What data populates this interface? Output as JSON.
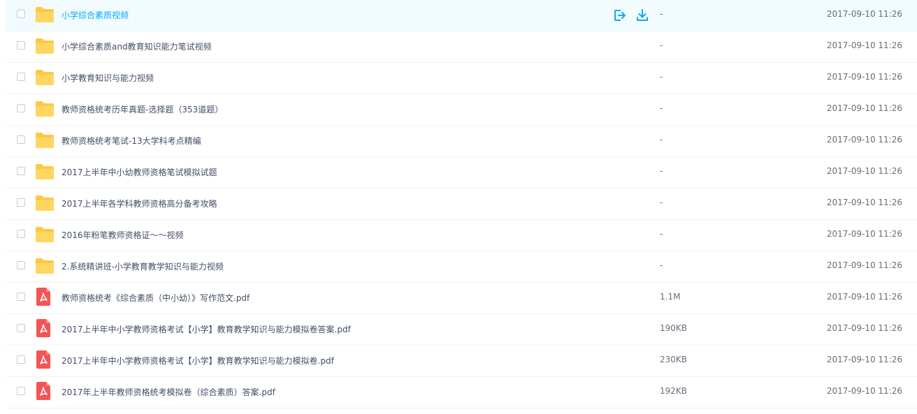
{
  "files": [
    {
      "name": "小学综合素质视频",
      "type": "folder",
      "size": "-",
      "date": "2017-09-10 11:26",
      "hovered": true
    },
    {
      "name": "小学综合素质and教育知识能力笔试视频",
      "type": "folder",
      "size": "-",
      "date": "2017-09-10 11:26"
    },
    {
      "name": "小学教育知识与能力视频",
      "type": "folder",
      "size": "-",
      "date": "2017-09-10 11:26"
    },
    {
      "name": "教师资格统考历年真题-选择题（353道题）",
      "type": "folder",
      "size": "-",
      "date": "2017-09-10 11:26"
    },
    {
      "name": "教师资格统考笔试-13大学科考点精编",
      "type": "folder",
      "size": "-",
      "date": "2017-09-10 11:26"
    },
    {
      "name": "2017上半年中小幼教师资格笔试模拟试题",
      "type": "folder",
      "size": "-",
      "date": "2017-09-10 11:26"
    },
    {
      "name": "2017上半年各学科教师资格高分备考攻略",
      "type": "folder",
      "size": "-",
      "date": "2017-09-10 11:26"
    },
    {
      "name": "2016年粉笔教师资格证～～视频",
      "type": "folder",
      "size": "-",
      "date": "2017-09-10 11:26"
    },
    {
      "name": "2.系统精讲班-小学教育教学知识与能力视频",
      "type": "folder",
      "size": "-",
      "date": "2017-09-10 11:26"
    },
    {
      "name": "教师资格统考《综合素质（中小幼）》写作范文.pdf",
      "type": "pdf",
      "size": "1.1M",
      "date": "2017-09-10 11:26"
    },
    {
      "name": "2017上半年中小学教师资格考试【小学】教育教学知识与能力模拟卷答案.pdf",
      "type": "pdf",
      "size": "190KB",
      "date": "2017-09-10 11:26"
    },
    {
      "name": "2017上半年中小学教师资格考试【小学】教育教学知识与能力模拟卷.pdf",
      "type": "pdf",
      "size": "230KB",
      "date": "2017-09-10 11:26"
    },
    {
      "name": "2017年上半年教师资格统考模拟卷（综合素质）答案.pdf",
      "type": "pdf",
      "size": "192KB",
      "date": "2017-09-10 11:26"
    }
  ],
  "colors": {
    "accent": "#09aaff",
    "folder": "#ffd04d",
    "pdf": "#f45454",
    "text": "#424e67",
    "muted": "#666e7a"
  },
  "icons": {
    "folder": "folder-icon",
    "pdf": "pdf-icon",
    "share": "share-icon",
    "download": "download-icon"
  }
}
